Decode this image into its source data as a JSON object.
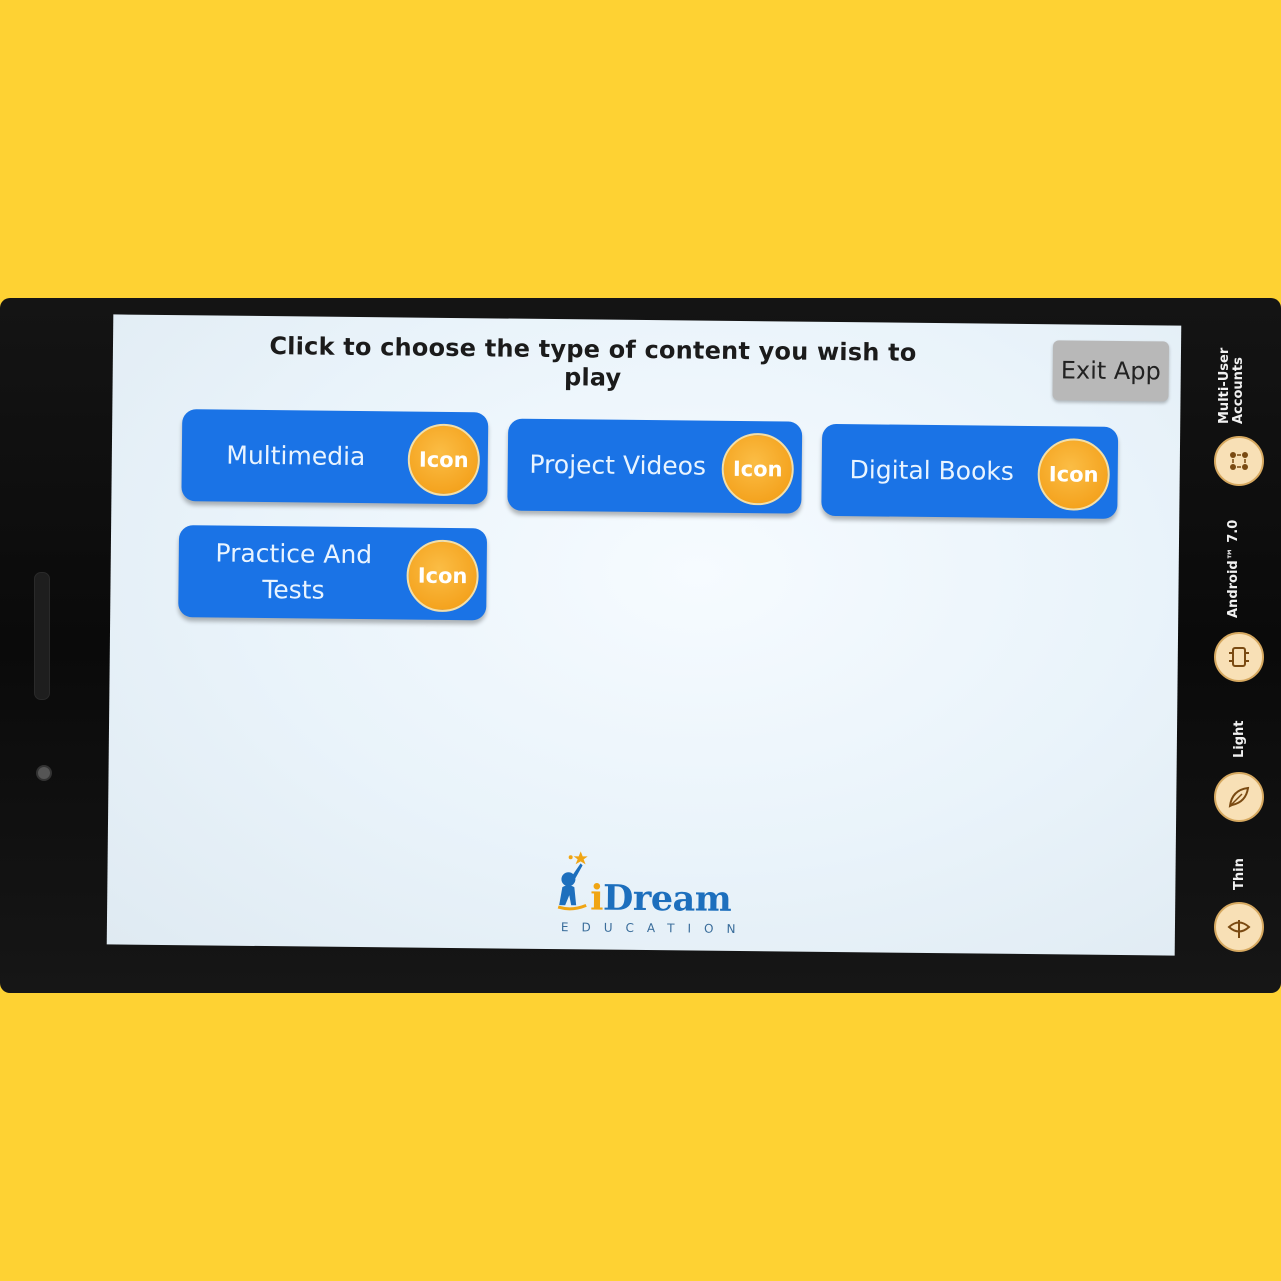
{
  "screen": {
    "title": "Click to choose the type of content you wish to play",
    "exit_label": "Exit App"
  },
  "cards": [
    {
      "label": "Multimedia",
      "icon_text": "Icon"
    },
    {
      "label": "Project Videos",
      "icon_text": "Icon"
    },
    {
      "label": "Digital Books",
      "icon_text": "Icon"
    },
    {
      "label": "Practice And Tests",
      "icon_text": "Icon"
    }
  ],
  "logo": {
    "brand_i": "i",
    "brand_rest": "Dream",
    "subtitle": "EDUCATION"
  },
  "side_features": [
    {
      "label": "Multi-User Accounts",
      "icon": "users-icon"
    },
    {
      "label": "Android™ 7.0",
      "icon": "android-icon"
    },
    {
      "label": "Light",
      "icon": "feather-icon"
    },
    {
      "label": "Thin",
      "icon": "thin-icon"
    }
  ],
  "colors": {
    "background": "#fed233",
    "card": "#1a73e6",
    "badge": "#f4a21d",
    "exit_button": "#b8b8b8"
  }
}
